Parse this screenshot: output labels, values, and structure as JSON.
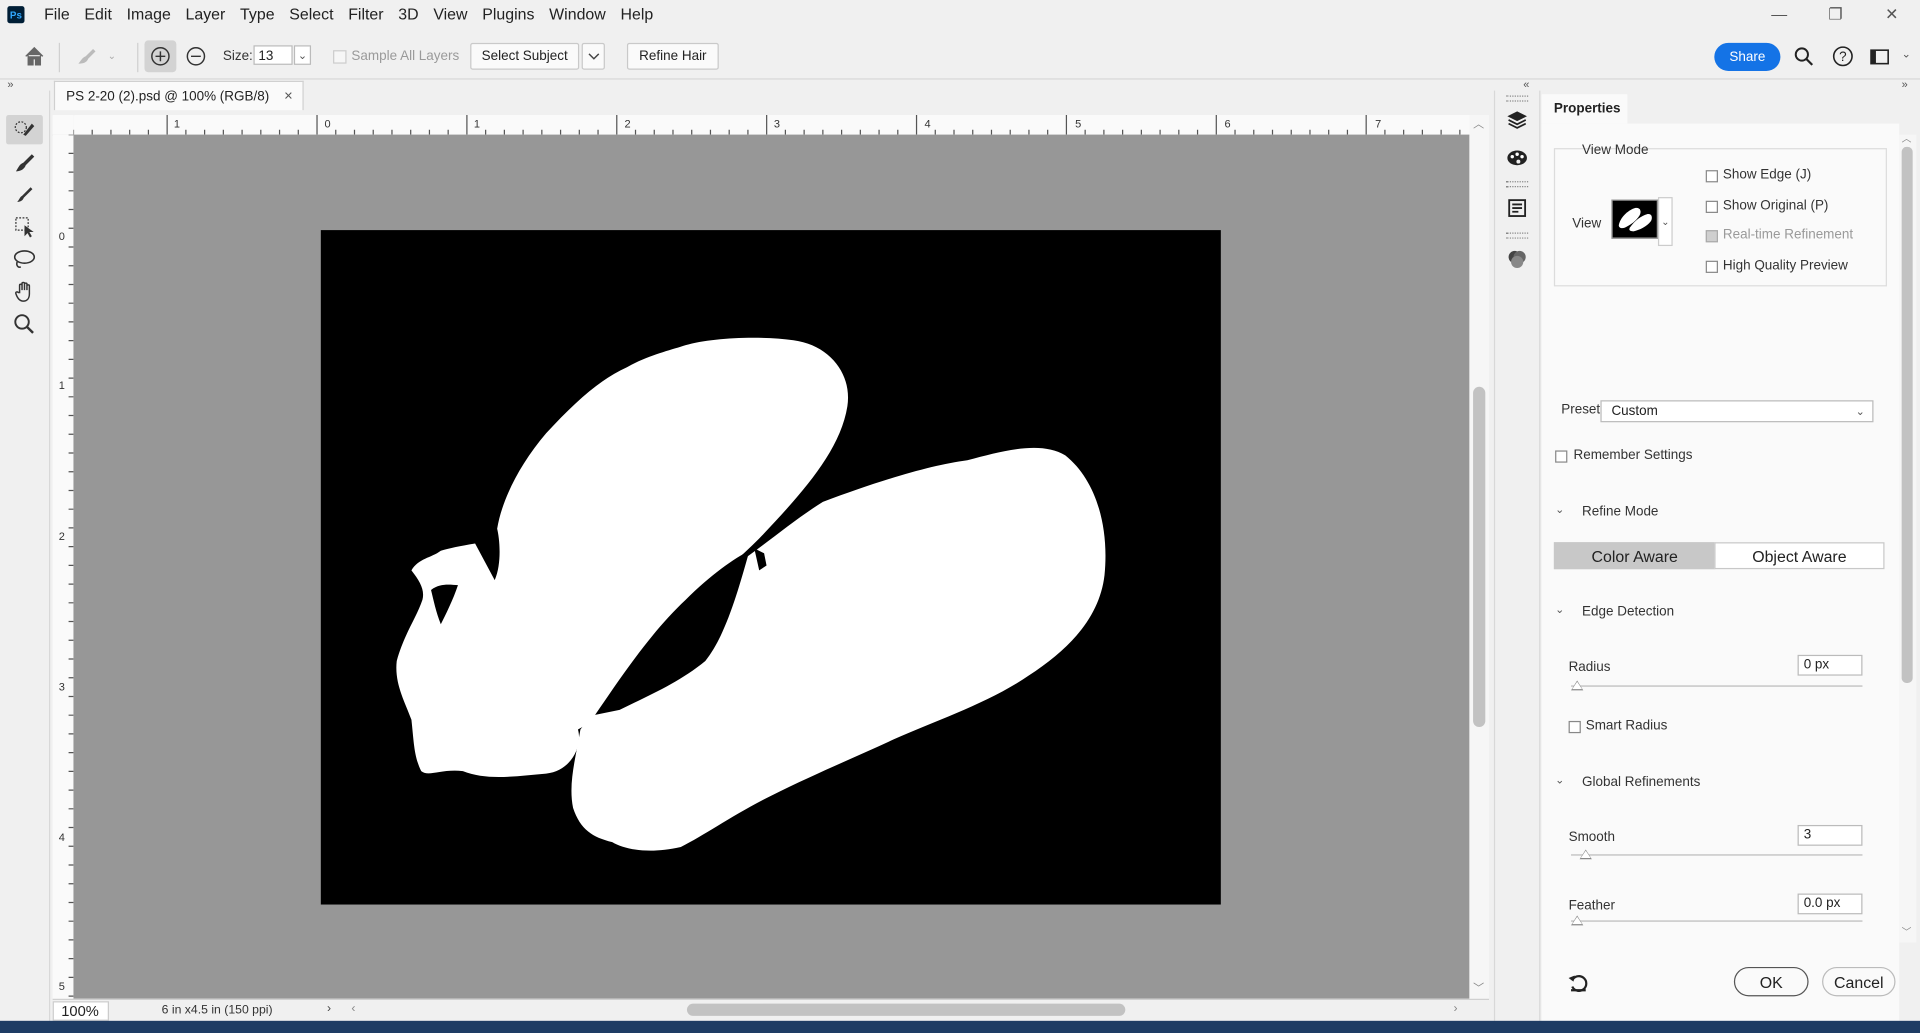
{
  "app": {
    "logo": "Ps",
    "menu": [
      "File",
      "Edit",
      "Image",
      "Layer",
      "Type",
      "Select",
      "Filter",
      "3D",
      "View",
      "Plugins",
      "Window",
      "Help"
    ],
    "window_controls": [
      "—",
      "❐",
      "✕"
    ]
  },
  "options_bar": {
    "size_label": "Size:",
    "size_value": "13",
    "sample_all_layers": "Sample All Layers",
    "select_subject": "Select Subject",
    "refine_hair": "Refine Hair",
    "share": "Share"
  },
  "document": {
    "tab_title": "PS 2-20 (2).psd @ 100% (RGB/8)",
    "tab_close": "×",
    "zoom": "100%",
    "info": "6 in x4.5 in (150 ppi)",
    "h_ruler_labels": [
      "1",
      "0",
      "1",
      "2",
      "3",
      "4",
      "5",
      "6",
      "7"
    ],
    "v_ruler_labels": [
      "0",
      "1",
      "2",
      "3",
      "4",
      "5"
    ]
  },
  "properties": {
    "tab": "Properties",
    "view_mode": {
      "title": "View Mode",
      "view_label": "View",
      "show_edge": "Show Edge (J)",
      "show_original": "Show Original (P)",
      "realtime_refinement": "Real-time Refinement",
      "high_quality_preview": "High Quality Preview"
    },
    "preset_label": "Preset",
    "preset_value": "Custom",
    "remember_settings": "Remember Settings",
    "refine_mode": {
      "title": "Refine Mode",
      "options": [
        "Color Aware",
        "Object Aware"
      ],
      "selected": "Color Aware"
    },
    "edge_detection": {
      "title": "Edge Detection",
      "radius_label": "Radius",
      "radius_value": "0 px",
      "smart_radius": "Smart Radius"
    },
    "global_refinements": {
      "title": "Global Refinements",
      "smooth_label": "Smooth",
      "smooth_value": "3",
      "feather_label": "Feather",
      "feather_value": "0.0 px"
    },
    "ok": "OK",
    "cancel": "Cancel"
  }
}
